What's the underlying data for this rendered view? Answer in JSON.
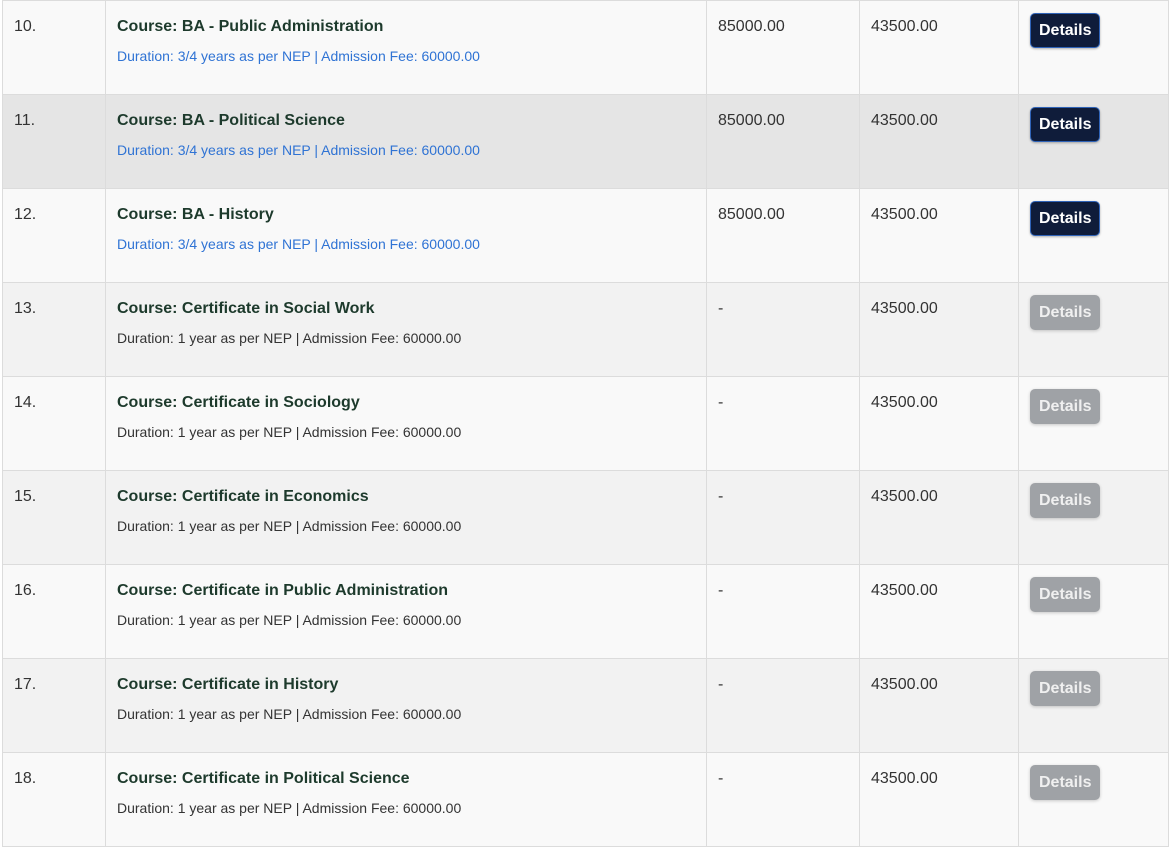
{
  "colors": {
    "course_title": "#1d3a2c",
    "meta_link": "#2f73d4",
    "button_active": "#0f1c3a",
    "button_disabled": "#9fa2a6"
  },
  "rows": [
    {
      "num": "10.",
      "title": "Course: BA - Public Administration",
      "meta": "Duration: 3/4 years as per NEP | Admission Fee: 60000.00",
      "fee1": "85000.00",
      "fee2": "43500.00",
      "button": "Details"
    },
    {
      "num": "11.",
      "title": "Course: BA - Political Science",
      "meta": "Duration: 3/4 years as per NEP | Admission Fee: 60000.00",
      "fee1": "85000.00",
      "fee2": "43500.00",
      "button": "Details"
    },
    {
      "num": "12.",
      "title": "Course: BA - History",
      "meta": "Duration: 3/4 years as per NEP | Admission Fee: 60000.00",
      "fee1": "85000.00",
      "fee2": "43500.00",
      "button": "Details"
    },
    {
      "num": "13.",
      "title": "Course: Certificate in Social Work",
      "meta": "Duration: 1 year as per NEP | Admission Fee: 60000.00",
      "fee1": "-",
      "fee2": "43500.00",
      "button": "Details"
    },
    {
      "num": "14.",
      "title": "Course: Certificate in Sociology",
      "meta": "Duration: 1 year as per NEP | Admission Fee: 60000.00",
      "fee1": "-",
      "fee2": "43500.00",
      "button": "Details"
    },
    {
      "num": "15.",
      "title": "Course: Certificate in Economics",
      "meta": "Duration: 1 year as per NEP | Admission Fee: 60000.00",
      "fee1": "-",
      "fee2": "43500.00",
      "button": "Details"
    },
    {
      "num": "16.",
      "title": "Course: Certificate in Public Administration",
      "meta": "Duration: 1 year as per NEP | Admission Fee: 60000.00",
      "fee1": "-",
      "fee2": "43500.00",
      "button": "Details"
    },
    {
      "num": "17.",
      "title": "Course: Certificate in History",
      "meta": "Duration: 1 year as per NEP | Admission Fee: 60000.00",
      "fee1": "-",
      "fee2": "43500.00",
      "button": "Details"
    },
    {
      "num": "18.",
      "title": "Course: Certificate in Political Science",
      "meta": "Duration: 1 year as per NEP | Admission Fee: 60000.00",
      "fee1": "-",
      "fee2": "43500.00",
      "button": "Details"
    }
  ]
}
